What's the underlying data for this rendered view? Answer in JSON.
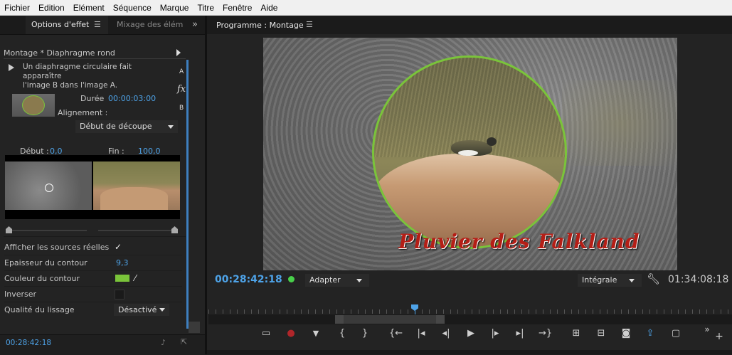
{
  "menu": [
    "Fichier",
    "Edition",
    "Elément",
    "Séquence",
    "Marque",
    "Titre",
    "Fenêtre",
    "Aide"
  ],
  "left": {
    "tab_active": "Options d'effet",
    "tab_inactive": "Mixage des élém",
    "header": "Montage * Diaphragme rond",
    "description": [
      "Un diaphragme circulaire fait apparaître",
      "l'image B dans l'image A."
    ],
    "label_a": "A",
    "label_b": "B",
    "fx": "fx",
    "duration_label": "Durée",
    "duration_value": "00:00:03:00",
    "alignment_label": "Alignement :",
    "alignment_value": "Début de découpe",
    "start_label": "Début :",
    "start_value": "0,0",
    "end_label": "Fin :",
    "end_value": "100,0",
    "props": {
      "show_sources": "Afficher les sources réelles",
      "border_width_label": "Epaisseur du contour",
      "border_width_value": "9,3",
      "border_color_label": "Couleur du contour",
      "invert_label": "Inverser",
      "smoothing_label": "Qualité du lissage",
      "smoothing_value": "Désactivé"
    },
    "timecode": "00:28:42:18"
  },
  "right": {
    "title": "Programme : Montage",
    "overlay_text": "Pluvier des Falkland",
    "timecode_current": "00:28:42:18",
    "fit_value": "Adapter",
    "quality_value": "Intégrale",
    "timecode_total": "01:34:08:18"
  },
  "colors": {
    "accent": "#4ea3e8",
    "border_color": "#7ac43a",
    "overlay_text": "#b51e16"
  }
}
